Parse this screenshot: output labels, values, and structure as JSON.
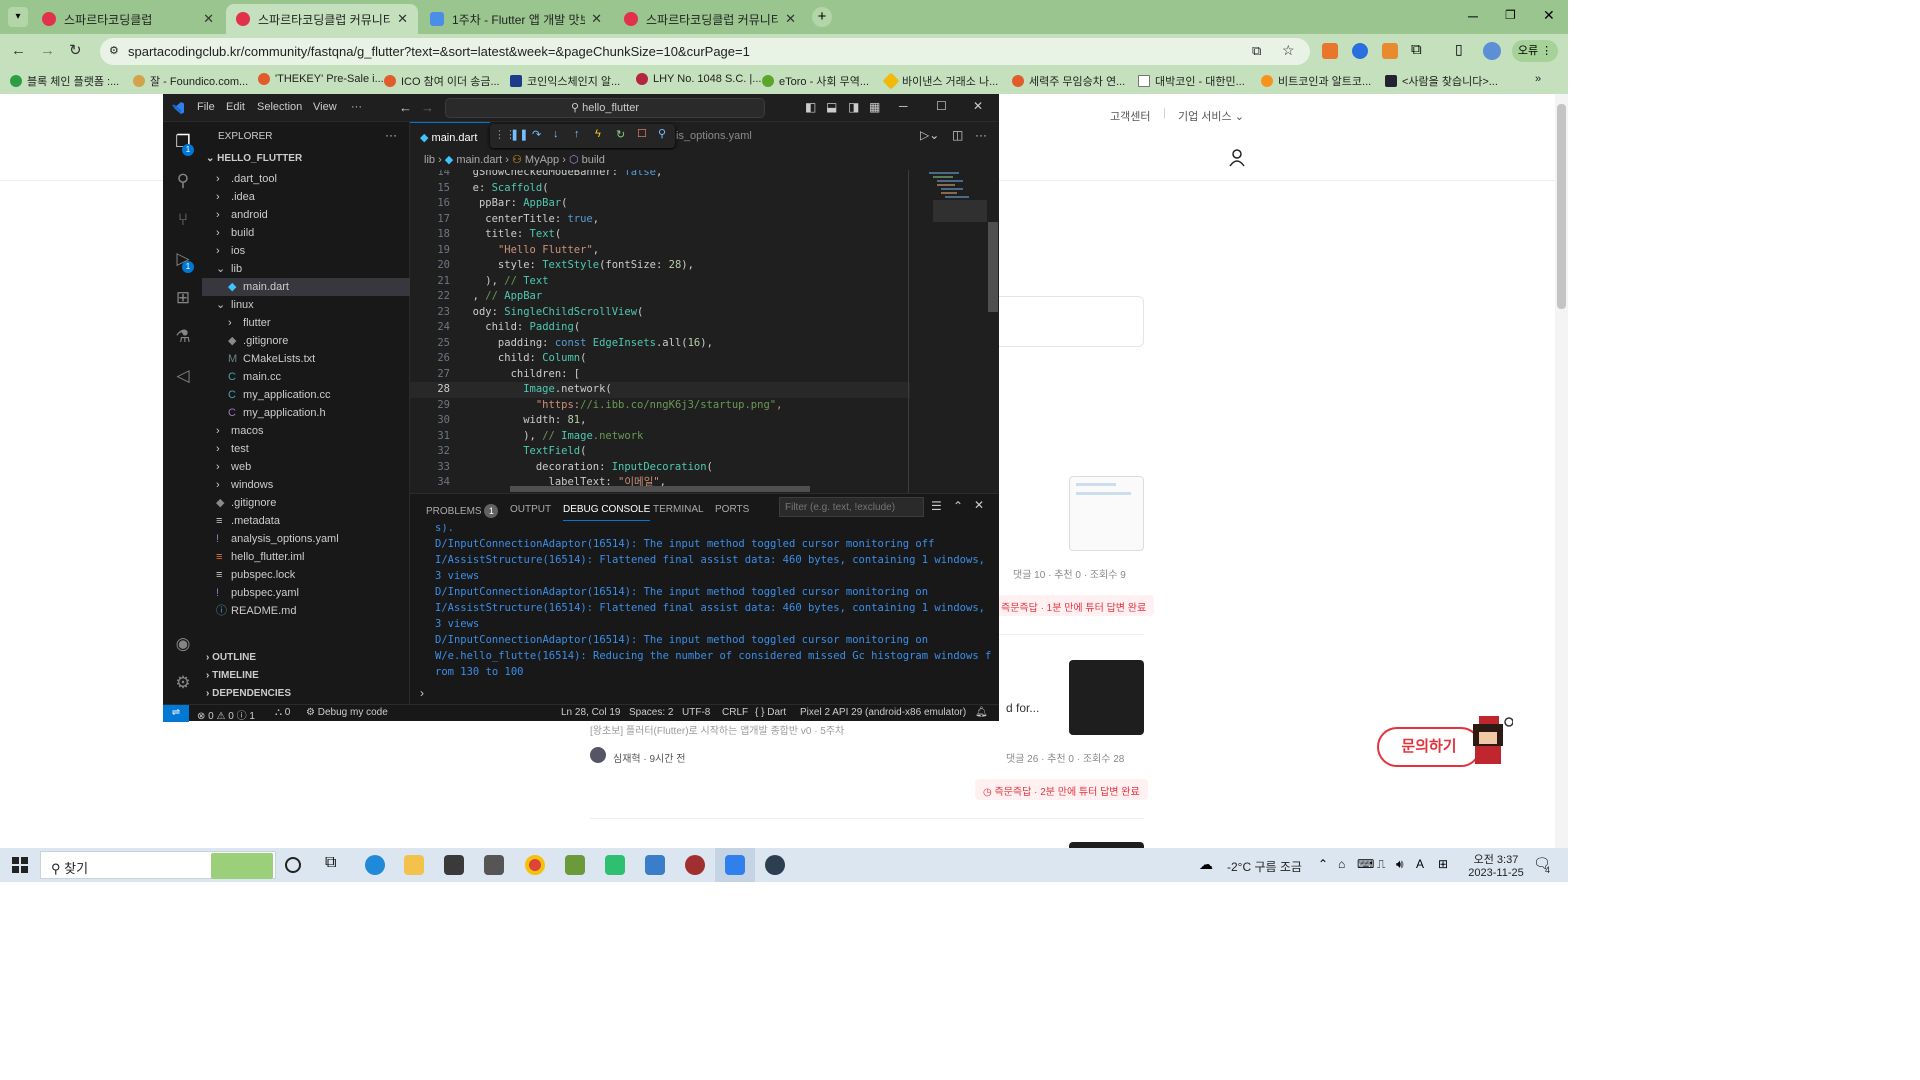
{
  "browser": {
    "tabs": [
      {
        "title": "스파르타코딩클럽",
        "icon": "heart-icon",
        "active": false
      },
      {
        "title": "스파르타코딩클럽 커뮤니티 | 스",
        "icon": "heart-icon",
        "active": true
      },
      {
        "title": "1주차 - Flutter 앱 개발 맛보기",
        "icon": "doc-icon",
        "active": false
      },
      {
        "title": "스파르타코딩클럽 커뮤니티 | 스",
        "icon": "heart-icon",
        "active": false
      }
    ],
    "url": "spartacodingclub.kr/community/fastqna/g_flutter?text=&sort=latest&week=&pageChunkSize=10&curPage=1",
    "profile_label": "오류",
    "bookmarks": [
      "블록 체인 플랫폼 :...",
      "잘 - Foundico.com...",
      "'THEKEY' Pre-Sale i...",
      "ICO 참여 이더 송금...",
      "코인익스체인지 알...",
      "LHY No. 1048 S.C. |...",
      "eToro - 사회 무역...",
      "바이낸스 거래소 나...",
      "세력주 무임승차 연...",
      "대박코인 - 대한민...",
      "비트코인과 알트코...",
      "<사람을 찾습니다>..."
    ]
  },
  "page": {
    "header_links": [
      "고객센터",
      "기업 서비스"
    ],
    "post1": {
      "meta": [
        "댓글 10",
        "추천 0",
        "조회수 9"
      ],
      "badge": "즉문즉답 · 1분 만에 튜터 답변 완료"
    },
    "post2": {
      "snippet": "d for...",
      "breadcrumb": "[왕초보] 플러터(Flutter)로 시작하는 앱개발 종합반 v0 · 5주차",
      "author": "심재혁 · 9시간 전",
      "meta": [
        "댓글 26",
        "추천 0",
        "조회수 28"
      ],
      "badge": "즉문즉답 · 2분 만에 튜터 답변 완료"
    },
    "ask_button": "문의하기"
  },
  "vscode": {
    "menu": [
      "File",
      "Edit",
      "Selection",
      "View",
      "···"
    ],
    "search": "hello_flutter",
    "explorer_title": "EXPLORER",
    "project": "HELLO_FLUTTER",
    "tree": [
      {
        "label": ".dart_tool",
        "indent": 1,
        "kind": "folder"
      },
      {
        "label": ".idea",
        "indent": 1,
        "kind": "folder"
      },
      {
        "label": "android",
        "indent": 1,
        "kind": "folder"
      },
      {
        "label": "build",
        "indent": 1,
        "kind": "folder"
      },
      {
        "label": "ios",
        "indent": 1,
        "kind": "folder"
      },
      {
        "label": "lib",
        "indent": 1,
        "kind": "open"
      },
      {
        "label": "main.dart",
        "indent": 2,
        "kind": "dart"
      },
      {
        "label": "linux",
        "indent": 1,
        "kind": "open"
      },
      {
        "label": "flutter",
        "indent": 2,
        "kind": "folder"
      },
      {
        "label": ".gitignore",
        "indent": 2,
        "kind": "git"
      },
      {
        "label": "CMakeLists.txt",
        "indent": 2,
        "kind": "cmake"
      },
      {
        "label": "main.cc",
        "indent": 2,
        "kind": "cpp"
      },
      {
        "label": "my_application.cc",
        "indent": 2,
        "kind": "cpp"
      },
      {
        "label": "my_application.h",
        "indent": 2,
        "kind": "h"
      },
      {
        "label": "macos",
        "indent": 1,
        "kind": "folder"
      },
      {
        "label": "test",
        "indent": 1,
        "kind": "folder"
      },
      {
        "label": "web",
        "indent": 1,
        "kind": "folder"
      },
      {
        "label": "windows",
        "indent": 1,
        "kind": "folder"
      },
      {
        "label": ".gitignore",
        "indent": 1,
        "kind": "git"
      },
      {
        "label": ".metadata",
        "indent": 1,
        "kind": "meta"
      },
      {
        "label": "analysis_options.yaml",
        "indent": 1,
        "kind": "yaml"
      },
      {
        "label": "hello_flutter.iml",
        "indent": 1,
        "kind": "iml"
      },
      {
        "label": "pubspec.lock",
        "indent": 1,
        "kind": "lock"
      },
      {
        "label": "pubspec.yaml",
        "indent": 1,
        "kind": "yaml"
      },
      {
        "label": "README.md",
        "indent": 1,
        "kind": "info"
      }
    ],
    "sections": [
      "OUTLINE",
      "TIMELINE",
      "DEPENDENCIES"
    ],
    "editor_tab": "main.dart",
    "other_tab": "is_options.yaml",
    "breadcrumb": [
      "lib",
      "main.dart",
      "MyApp",
      "build"
    ],
    "code_lines": [
      {
        "n": "14",
        "t": "  gShowCheckedModeBanner: false,"
      },
      {
        "n": "15",
        "t": "  e: Scaffold("
      },
      {
        "n": "16",
        "t": "   ppBar: AppBar("
      },
      {
        "n": "17",
        "t": "    centerTitle: true,"
      },
      {
        "n": "18",
        "t": "    title: Text("
      },
      {
        "n": "19",
        "t": "      \"Hello Flutter\","
      },
      {
        "n": "20",
        "t": "      style: TextStyle(fontSize: 28),"
      },
      {
        "n": "21",
        "t": "    ), // Text"
      },
      {
        "n": "22",
        "t": "  , // AppBar"
      },
      {
        "n": "23",
        "t": "  ody: SingleChildScrollView("
      },
      {
        "n": "24",
        "t": "    child: Padding("
      },
      {
        "n": "25",
        "t": "      padding: const EdgeInsets.all(16),"
      },
      {
        "n": "26",
        "t": "      child: Column("
      },
      {
        "n": "27",
        "t": "        children: ["
      },
      {
        "n": "28",
        "t": "          Image.network("
      },
      {
        "n": "29",
        "t": "            \"https://i.ibb.co/nngK6j3/startup.png\","
      },
      {
        "n": "30",
        "t": "          width: 81,"
      },
      {
        "n": "31",
        "t": "          ), // Image.network"
      },
      {
        "n": "32",
        "t": "          TextField("
      },
      {
        "n": "33",
        "t": "            decoration: InputDecoration("
      },
      {
        "n": "34",
        "t": "              labelText: \"이메일\","
      }
    ],
    "panel_tabs": [
      "PROBLEMS",
      "OUTPUT",
      "DEBUG CONSOLE",
      "TERMINAL",
      "PORTS"
    ],
    "problems_count": "1",
    "filter_placeholder": "Filter (e.g. text, !exclude)",
    "console": [
      "s).",
      "D/InputConnectionAdaptor(16514): The input method toggled cursor monitoring off",
      "I/AssistStructure(16514): Flattened final assist data: 460 bytes, containing 1 windows,",
      "3 views",
      "D/InputConnectionAdaptor(16514): The input method toggled cursor monitoring on",
      "I/AssistStructure(16514): Flattened final assist data: 460 bytes, containing 1 windows,",
      "3 views",
      "D/InputConnectionAdaptor(16514): The input method toggled cursor monitoring on",
      "W/e.hello_flutte(16514): Reducing the number of considered missed Gc histogram windows f",
      "rom 130 to 100"
    ],
    "status": {
      "errors": "⊗ 0 ⚠ 0 ⓘ 1",
      "ports": "0",
      "debug": "Debug my code",
      "position": "Ln 28, Col 19",
      "spaces": "Spaces: 2",
      "encoding": "UTF-8",
      "eol": "CRLF",
      "lang": "{ } Dart",
      "device": "Pixel 2 API 29 (android-x86 emulator)"
    }
  },
  "taskbar": {
    "search": "찾기",
    "weather": "-2°C  구름 조금",
    "time": "오전 3:37",
    "date": "2023-11-25",
    "notifications": "4",
    "ime": "A"
  }
}
